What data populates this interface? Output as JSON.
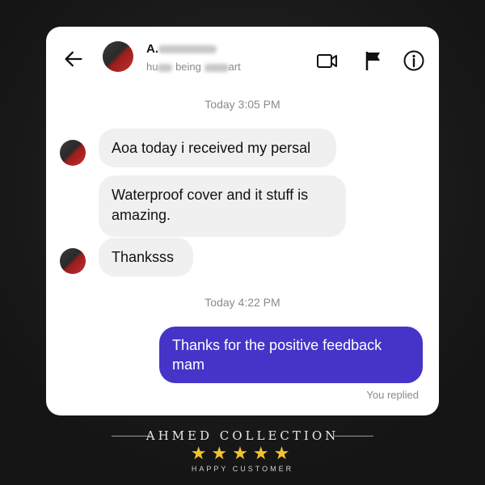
{
  "header": {
    "name": "A.",
    "subtitle_parts": [
      "hu",
      " being ",
      "art"
    ]
  },
  "messages": {
    "timestamp1": "Today 3:05 PM",
    "in1": "Aoa today i received my persal",
    "in2": "Waterproof cover and it stuff is amazing.",
    "in3": "Thanksss",
    "timestamp2": "Today 4:22 PM",
    "out1": "Thanks for the positive feedback mam",
    "replied": "You replied"
  },
  "footer": {
    "brand": "AHMED COLLECTION",
    "stars": "★★★★★",
    "tagline": "HAPPY CUSTOMER"
  },
  "colors": {
    "outgoing_bubble": "#4634c9",
    "incoming_bubble": "#f0f0f0",
    "stars": "#f2c230"
  },
  "icons": [
    "back-arrow-icon",
    "video-call-icon",
    "flag-icon",
    "info-icon"
  ]
}
